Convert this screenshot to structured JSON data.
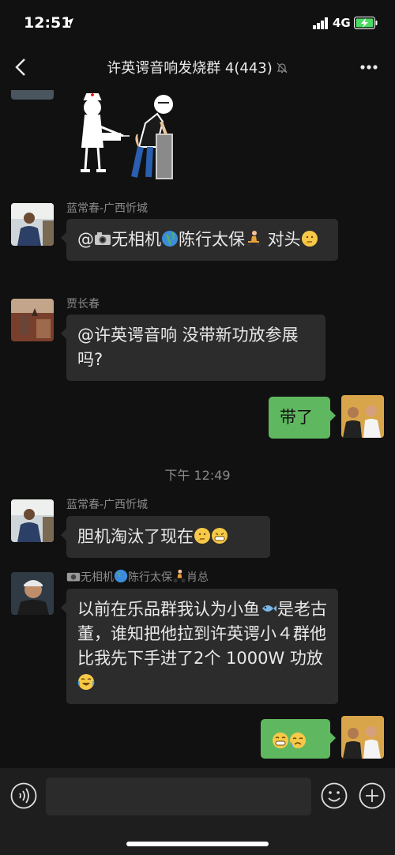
{
  "status_bar": {
    "time": "12:51",
    "network": "4G"
  },
  "header": {
    "title": "许英谔音响发烧群 4(443)"
  },
  "messages": [
    {
      "sender": "蓝常春-广西忻城",
      "pre": "@",
      "mid1": "无相机",
      "mid2": "陈行太保",
      "mid3": " 对头"
    },
    {
      "sender": "贾长春",
      "text": "@许英谔音响 没带新功放参展吗?"
    },
    {
      "text": "带了"
    },
    {
      "sender": "蓝常春-广西忻城",
      "text": "胆机淘汰了现在"
    },
    {
      "sender_a": "无相机",
      "sender_b": "陈行太保",
      "sender_c": "肖总",
      "text_a": "以前在乐品群我认为小鱼",
      "text_b": "是老古董，谁知把他拉到许英谔小４群他比我先下手进了2个 1000W 功放"
    }
  ],
  "timestamp": "下午 12:49",
  "colors": {
    "background": "#111111",
    "bubble_other": "#2c2c2c",
    "bubble_self": "#5fb85f"
  },
  "icons": [
    "location-arrow-icon",
    "signal-icon",
    "battery-charging-icon",
    "back-icon",
    "mute-icon",
    "more-icon",
    "voice-icon",
    "emoji-icon",
    "plus-icon"
  ]
}
